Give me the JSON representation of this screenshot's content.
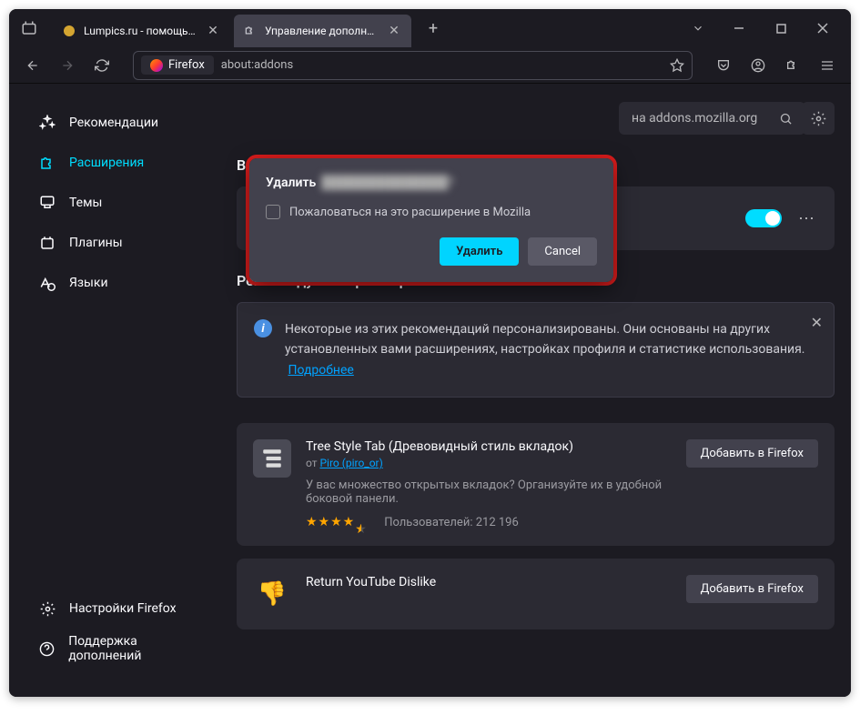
{
  "tabs": [
    {
      "title": "Lumpics.ru - помощь с компь"
    },
    {
      "title": "Управление дополнениями"
    }
  ],
  "urlbar": {
    "prefix": "Firefox",
    "path": "about:addons"
  },
  "sidebar": {
    "items": [
      {
        "label": "Рекомендации"
      },
      {
        "label": "Расширения"
      },
      {
        "label": "Темы"
      },
      {
        "label": "Плагины"
      },
      {
        "label": "Языки"
      }
    ],
    "footer": [
      {
        "label": "Настройки Firefox"
      },
      {
        "label": "Поддержка дополнений"
      }
    ]
  },
  "search": {
    "placeholder": "на addons.mozilla.org"
  },
  "sections": {
    "enabled_title": "Включены",
    "recommended_title": "Рекомендуемые расширения"
  },
  "enabled_ext": {
    "name": "████████████████",
    "desc": "███████████████████████████████████"
  },
  "banner": {
    "text": "Некоторые из этих рекомендаций персонализированы. Они основаны на других установленных вами расширениях, настройках профиля и статистике использования.",
    "link": "Подробнее"
  },
  "recs": [
    {
      "title": "Tree Style Tab (Древовидный стиль вкладок)",
      "author_prefix": "от ",
      "author": "Piro (piro_or)",
      "desc": "У вас множество открытых вкладок? Организуйте их в удобной боковой панели.",
      "users_label": "Пользователей: 212 196",
      "add_btn": "Добавить в Firefox"
    },
    {
      "title": "Return YouTube Dislike",
      "author_prefix": "",
      "author": "",
      "desc": "",
      "users_label": "",
      "add_btn": "Добавить в Firefox"
    }
  ],
  "dialog": {
    "title": "Удалить",
    "title_blurred": "██████████████?",
    "checkbox_label": "Пожаловаться на это расширение в Mozilla",
    "confirm": "Удалить",
    "cancel": "Cancel"
  }
}
